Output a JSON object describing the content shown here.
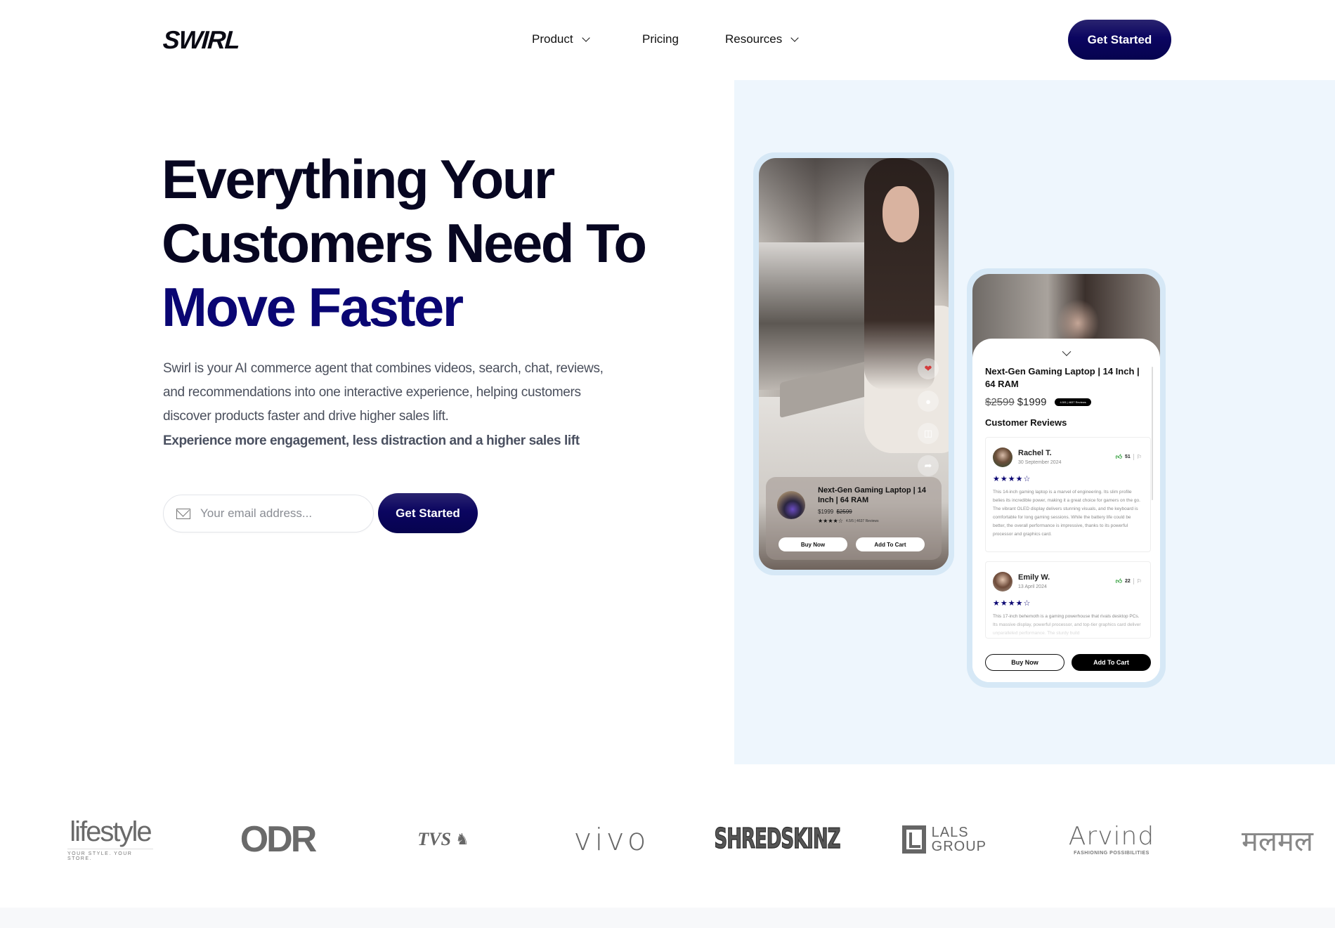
{
  "nav": {
    "logo": "SWIRL",
    "items": [
      {
        "label": "Product",
        "has_dropdown": true
      },
      {
        "label": "Pricing",
        "has_dropdown": false
      },
      {
        "label": "Resources",
        "has_dropdown": true
      }
    ],
    "cta_label": "Get Started"
  },
  "hero": {
    "title_line1": "Everything Your",
    "title_line2": "Customers Need To",
    "title_accent": "Move Faster",
    "description": "Swirl is your AI commerce agent that combines videos, search, chat, reviews, and recommendations into one interactive experience, helping customers discover products faster and drive higher sales lift.",
    "tagline": "Experience more engagement, less distraction and a higher sales lift",
    "email_placeholder": "Your email address...",
    "email_value": "",
    "cta_label": "Get Started",
    "accent_color": "#0a0673"
  },
  "video_card": {
    "side_actions": [
      "heart-icon",
      "comment-icon",
      "cart-icon",
      "share-icon"
    ],
    "product_name": "Next-Gen Gaming Laptop | 14 Inch | 64 RAM",
    "price": "$1999",
    "original_price": "$2599",
    "stars": "★★★★☆",
    "rating_meta": "4.5/5 | 4637 Reviews",
    "buy_label": "Buy Now",
    "cart_label": "Add To Cart"
  },
  "detail_card": {
    "product_name": "Next-Gen Gaming Laptop | 14 Inch | 64 RAM",
    "original_price": "$2599",
    "price": "$1999",
    "rating_badge": "4.5/5 | 4637 Reviews",
    "reviews_heading": "Customer Reviews",
    "reviews": [
      {
        "name": "Rachel T.",
        "date": "30 September 2024",
        "likes": "51",
        "stars": "★★★★☆",
        "text": "This 14-inch gaming laptop is a marvel of engineering. Its slim profile belies its incredible power, making it a great choice for gamers on the go. The vibrant OLED display delivers stunning visuals, and the keyboard is comfortable for long gaming sessions. While the battery life could be better, the overall performance is impressive, thanks to its powerful processor and graphics card."
      },
      {
        "name": "Emily W.",
        "date": "13 April 2024",
        "likes": "22",
        "stars": "★★★★☆",
        "text": "This 17-inch behemoth is a gaming powerhouse that rivals desktop PCs. Its massive display, powerful processor, and top-tier graphics card deliver unparalleled performance. The sturdy build"
      }
    ],
    "buy_label": "Buy Now",
    "cart_label": "Add To Cart"
  },
  "brand_logos": [
    {
      "name": "lifestyle",
      "text": "lifestyle",
      "subtext": "YOUR STYLE. YOUR STORE."
    },
    {
      "name": "odr",
      "text": "ODR"
    },
    {
      "name": "tvs",
      "text": "TVS"
    },
    {
      "name": "vivo",
      "text": "vivo"
    },
    {
      "name": "shredskinz",
      "text": "SHREDSKINZ"
    },
    {
      "name": "lals-group",
      "text": "LALS",
      "subtext": "GROUP"
    },
    {
      "name": "arvind",
      "text": "Arvind",
      "subtext": "FASHIONING POSSIBILITIES"
    },
    {
      "name": "malmal",
      "text": "मलमल"
    }
  ]
}
